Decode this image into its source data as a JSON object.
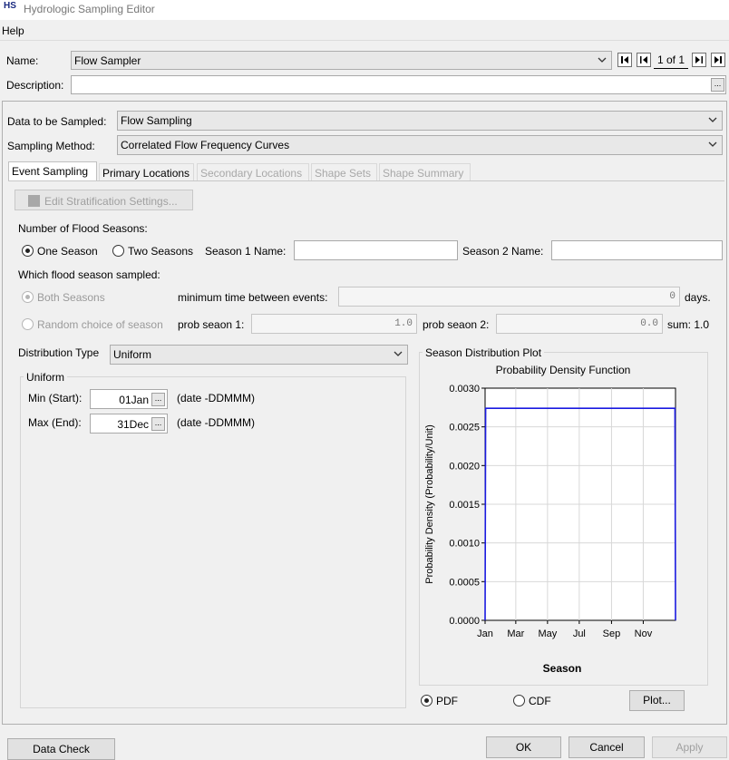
{
  "window": {
    "title": "Hydrologic Sampling Editor",
    "logo_text": "HS"
  },
  "menu": {
    "help": "Help"
  },
  "name_row": {
    "label": "Name:",
    "value": "Flow Sampler",
    "record": "1 of 1"
  },
  "description_row": {
    "label": "Description:",
    "value": "",
    "ellipsis": "..."
  },
  "data_sampled": {
    "label": "Data to be Sampled:",
    "value": "Flow Sampling"
  },
  "sampling_method": {
    "label": "Sampling Method:",
    "value": "Correlated Flow Frequency Curves"
  },
  "tabs": [
    {
      "label": "Event Sampling",
      "state": "active"
    },
    {
      "label": "Primary Locations",
      "state": "normal"
    },
    {
      "label": "Secondary Locations",
      "state": "disabled"
    },
    {
      "label": "Shape Sets",
      "state": "disabled"
    },
    {
      "label": "Shape Summary",
      "state": "disabled"
    }
  ],
  "edit_stratification": {
    "label": "Edit Stratification Settings..."
  },
  "flood_seasons": {
    "label": "Number of Flood Seasons:",
    "one_season": "One Season",
    "two_seasons": "Two Seasons",
    "season1_label": "Season 1 Name:",
    "season1_value": "",
    "season2_label": "Season 2 Name:",
    "season2_value": ""
  },
  "which_season": {
    "label": "Which flood season sampled:",
    "both": "Both Seasons",
    "random": "Random choice of season",
    "min_time_label": "minimum time between events:",
    "min_time_value": "0",
    "days": "days.",
    "prob1_label": "prob seaon 1:",
    "prob1_value": "1.0",
    "prob2_label": "prob seaon 2:",
    "prob2_value": "0.0",
    "sum": "sum: 1.0"
  },
  "distribution": {
    "label": "Distribution Type",
    "value": "Uniform"
  },
  "uniform": {
    "group_label": "Uniform",
    "min_label": "Min (Start):",
    "min_value": "01Jan",
    "max_label": "Max (End):",
    "max_value": "31Dec",
    "hint": "(date -DDMMM)"
  },
  "plot_panel": {
    "label": "Season Distribution Plot",
    "pdf": "PDF",
    "cdf": "CDF",
    "plot_button": "Plot..."
  },
  "chart_data": {
    "type": "line",
    "title": "Probability Density Function",
    "xlabel": "Season",
    "ylabel": "Probability Density (Probability/Unit)",
    "x_ticks": [
      "Jan",
      "Mar",
      "May",
      "Jul",
      "Sep",
      "Nov"
    ],
    "y_ticks": [
      "0.0000",
      "0.0005",
      "0.0010",
      "0.0015",
      "0.0020",
      "0.0025",
      "0.0030"
    ],
    "ylim": [
      0,
      0.003
    ],
    "xlim": [
      0,
      366
    ],
    "grid": true,
    "series_color": "#1a1ae0",
    "points": [
      [
        0,
        0
      ],
      [
        1,
        0.00274
      ],
      [
        365,
        0.00274
      ],
      [
        366,
        0
      ]
    ]
  },
  "footer": {
    "data_check": "Data Check",
    "ok": "OK",
    "cancel": "Cancel",
    "apply": "Apply"
  }
}
